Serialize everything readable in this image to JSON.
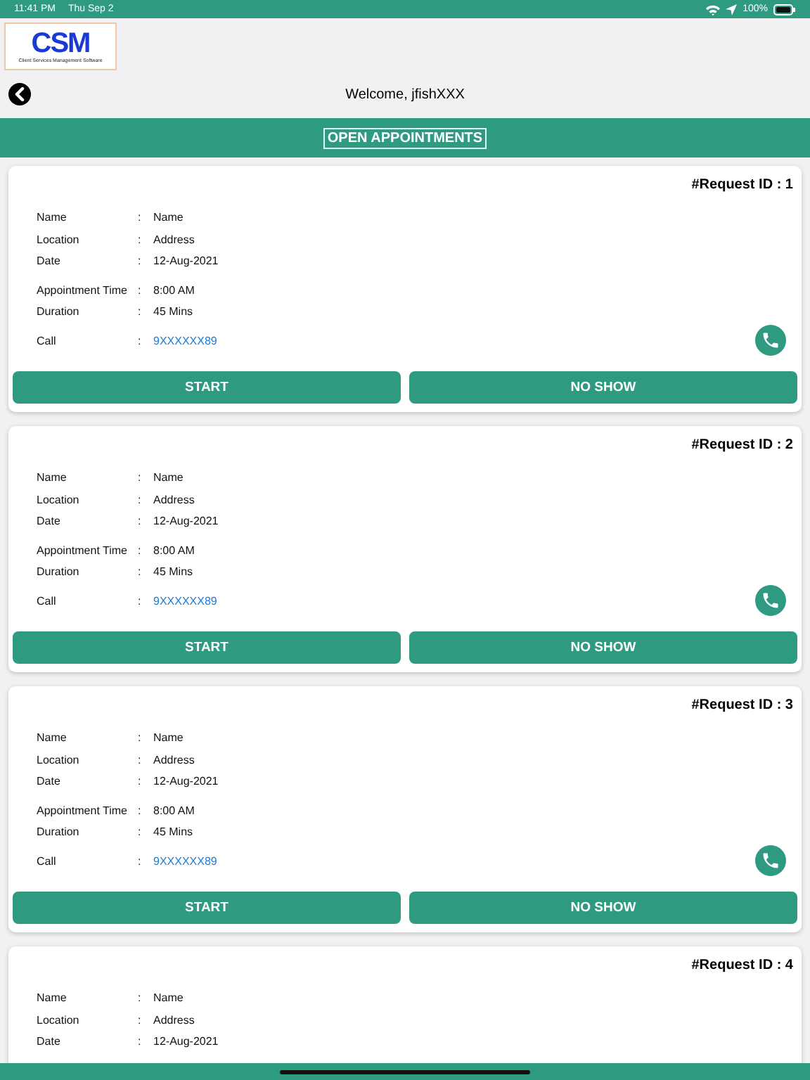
{
  "status_bar": {
    "time": "11:41 PM",
    "date": "Thu Sep 2",
    "battery": "100%"
  },
  "logo": {
    "mark": "CSM",
    "tagline": "Client Services Management Software"
  },
  "header": {
    "welcome": "Welcome, jfishXXX"
  },
  "section_title": "OPEN APPOINTMENTS",
  "separator": ":",
  "cards": [
    {
      "request": "#Request ID : 1",
      "sections": [
        [
          {
            "label": "Name",
            "value": "Name",
            "kind": "text"
          },
          {
            "label": "Location",
            "value": "Address",
            "kind": "text"
          },
          {
            "label": "Date",
            "value": "12-Aug-2021",
            "kind": "text"
          }
        ],
        [
          {
            "label": "Appointment Time",
            "value": "8:00 AM",
            "kind": "text"
          },
          {
            "label": "Duration",
            "value": "45 Mins",
            "kind": "text"
          }
        ],
        [
          {
            "label": "Call",
            "value": "9XXXXXX89",
            "kind": "phone"
          }
        ]
      ],
      "buttons": [
        "START",
        "NO SHOW"
      ]
    },
    {
      "request": "#Request ID : 2",
      "sections": [
        [
          {
            "label": "Name",
            "value": "Name",
            "kind": "text"
          },
          {
            "label": "Location",
            "value": "Address",
            "kind": "text"
          },
          {
            "label": "Date",
            "value": "12-Aug-2021",
            "kind": "text"
          }
        ],
        [
          {
            "label": "Appointment Time",
            "value": "8:00 AM",
            "kind": "text"
          },
          {
            "label": "Duration",
            "value": "45 Mins",
            "kind": "text"
          }
        ],
        [
          {
            "label": "Call",
            "value": "9XXXXXX89",
            "kind": "phone"
          }
        ]
      ],
      "buttons": [
        "START",
        "NO SHOW"
      ]
    },
    {
      "request": "#Request ID : 3",
      "sections": [
        [
          {
            "label": "Name",
            "value": "Name",
            "kind": "text"
          },
          {
            "label": "Location",
            "value": "Address",
            "kind": "text"
          },
          {
            "label": "Date",
            "value": "12-Aug-2021",
            "kind": "text"
          }
        ],
        [
          {
            "label": "Appointment Time",
            "value": "8:00 AM",
            "kind": "text"
          },
          {
            "label": "Duration",
            "value": "45 Mins",
            "kind": "text"
          }
        ],
        [
          {
            "label": "Call",
            "value": "9XXXXXX89",
            "kind": "phone"
          }
        ]
      ],
      "buttons": [
        "START",
        "NO SHOW"
      ]
    },
    {
      "request": "#Request ID : 4",
      "sections": [
        [
          {
            "label": "Name",
            "value": "Name",
            "kind": "text"
          },
          {
            "label": "Location",
            "value": "Address",
            "kind": "text"
          },
          {
            "label": "Date",
            "value": "12-Aug-2021",
            "kind": "text"
          }
        ]
      ]
    }
  ]
}
